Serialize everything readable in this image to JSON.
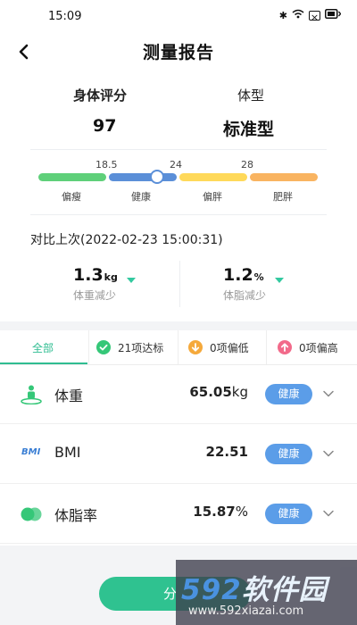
{
  "status_bar": {
    "time": "15:09",
    "icons": [
      "bluetooth-icon",
      "wifi-icon",
      "sim-icon",
      "battery-icon"
    ]
  },
  "header": {
    "title": "测量报告"
  },
  "summary": {
    "score_label": "身体评分",
    "score_value": "97",
    "type_label": "体型",
    "type_value": "标准型"
  },
  "bmi_scale": {
    "thresholds": [
      "18.5",
      "24",
      "28"
    ],
    "segments": [
      {
        "label": "偏瘦",
        "color": "#5fd07a"
      },
      {
        "label": "健康",
        "color": "#5b8fd8"
      },
      {
        "label": "偏胖",
        "color": "#ffd95a"
      },
      {
        "label": "肥胖",
        "color": "#f9b461"
      }
    ],
    "marker_segment": "健康"
  },
  "comparison": {
    "title": "对比上次(2022-02-23 15:00:31)",
    "weight": {
      "value": "1.3",
      "unit": "kg",
      "label": "体重减少"
    },
    "fat": {
      "value": "1.2",
      "unit": "%",
      "label": "体脂减少"
    }
  },
  "tabs": [
    {
      "label": "全部",
      "active": true
    },
    {
      "label": "21项达标",
      "icon": "check-icon",
      "color": "#35c778"
    },
    {
      "label": "0项偏低",
      "icon": "arrow-down-icon",
      "color": "#f5a93b"
    },
    {
      "label": "0项偏高",
      "icon": "arrow-up-icon",
      "color": "#f26a8a"
    }
  ],
  "metrics": [
    {
      "name": "体重",
      "value": "65.05",
      "unit": "kg",
      "status": "健康",
      "icon": "person-scale-icon"
    },
    {
      "name": "BMI",
      "value": "22.51",
      "unit": "",
      "status": "健康",
      "icon": "bmi-icon",
      "icon_text": "BMI"
    },
    {
      "name": "体脂率",
      "value": "15.87",
      "unit": "%",
      "status": "健康",
      "icon": "body-fat-icon"
    }
  ],
  "share_button": {
    "label": "分"
  },
  "watermark": {
    "main_num": "592",
    "main_text": "软件园",
    "url": "www.592xiazai.com"
  },
  "colors": {
    "accent": "#2fbd91",
    "badge": "#5b9de8",
    "decrease": "#33c9a0"
  }
}
